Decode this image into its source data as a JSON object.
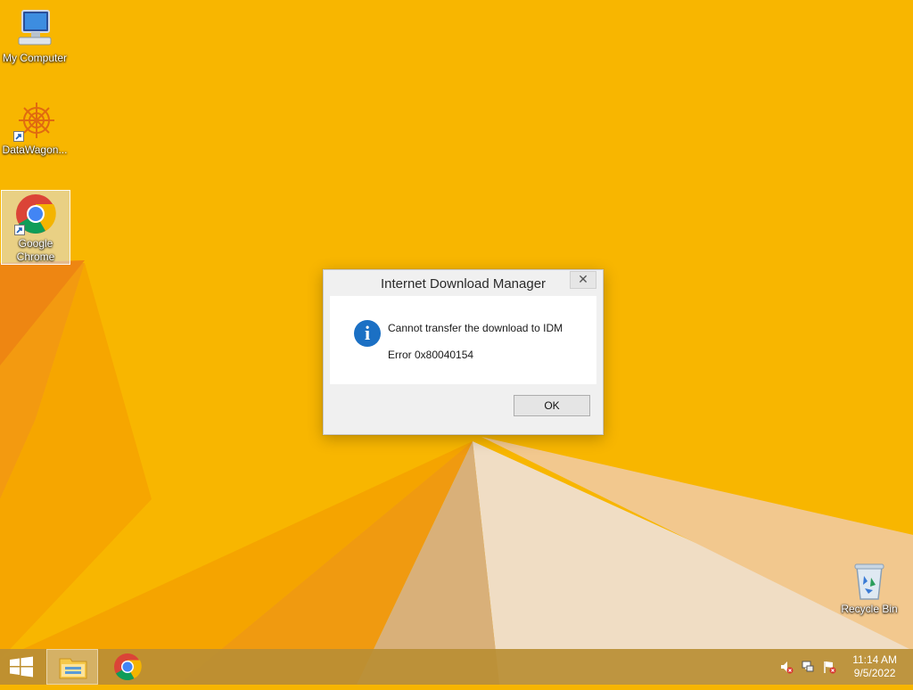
{
  "desktop": {
    "icons": [
      {
        "label": "My Computer"
      },
      {
        "label": "DataWagon..."
      },
      {
        "label_line1": "Google",
        "label_line2": "Chrome"
      },
      {
        "label": "Recycle Bin"
      }
    ]
  },
  "dialog": {
    "title": "Internet Download Manager",
    "close_label": "✕",
    "message": "Cannot transfer the download to IDM",
    "error": "Error 0x80040154",
    "info_icon_glyph": "i",
    "ok_label": "OK"
  },
  "taskbar": {
    "clock_time": "11:14 AM",
    "clock_date": "9/5/2022"
  },
  "colors": {
    "wallpaper": "#f7b500",
    "accent": "#1b70c4"
  }
}
